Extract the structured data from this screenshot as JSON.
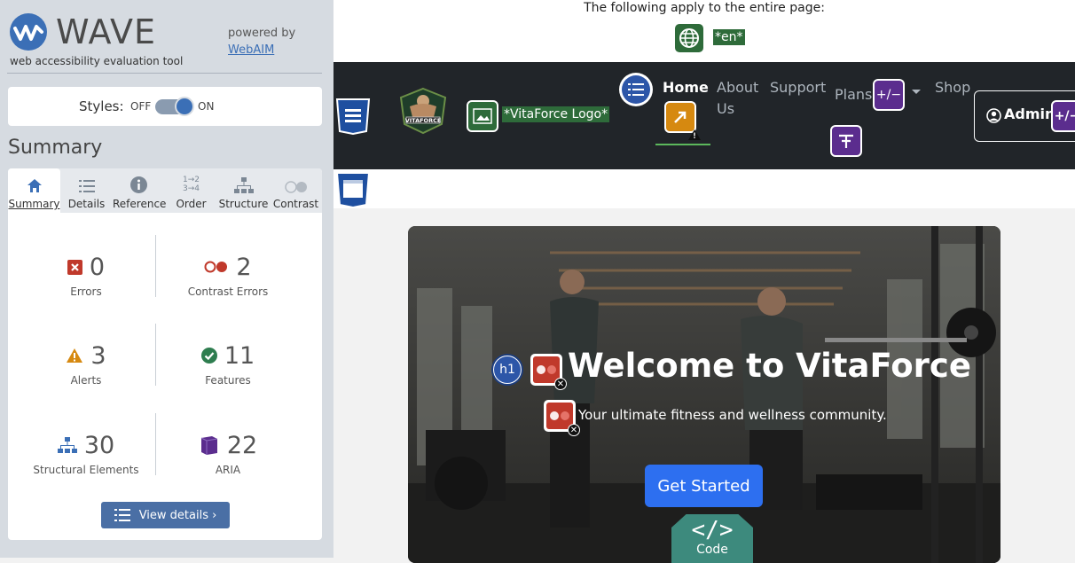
{
  "wave": {
    "title": "WAVE",
    "subtitle": "web accessibility evaluation tool",
    "powered_by": "powered by",
    "webaim_link": "WebAIM",
    "styles_label": "Styles:",
    "styles_off": "OFF",
    "styles_on": "ON",
    "summary_heading": "Summary",
    "tabs": [
      {
        "label": "Summary",
        "icon": "home-icon"
      },
      {
        "label": "Details",
        "icon": "list-icon"
      },
      {
        "label": "Reference",
        "icon": "info-icon"
      },
      {
        "label": "Order",
        "icon": "order-icon"
      },
      {
        "label": "Structure",
        "icon": "structure-icon"
      },
      {
        "label": "Contrast",
        "icon": "contrast-icon"
      }
    ],
    "stats": {
      "errors": {
        "count": "0",
        "label": "Errors"
      },
      "contrast_errors": {
        "count": "2",
        "label": "Contrast Errors"
      },
      "alerts": {
        "count": "3",
        "label": "Alerts"
      },
      "features": {
        "count": "11",
        "label": "Features"
      },
      "structural": {
        "count": "30",
        "label": "Structural Elements"
      },
      "aria": {
        "count": "22",
        "label": "ARIA"
      }
    },
    "view_details": "View details ›",
    "colors": {
      "accent": "#3b6fb6",
      "error": "#c0392b",
      "alert": "#d68910",
      "feature": "#2e7d4f",
      "aria": "#5b2d8e"
    }
  },
  "page": {
    "applies_text": "The following apply to the entire page:",
    "lang_tag": "*en*",
    "logo_alt_tag": "*VitaForce Logo*",
    "nav": {
      "home": "Home",
      "about": "About Us",
      "support": "Support",
      "plans": "Plans",
      "shop": "Shop",
      "admin": "Admin",
      "aria_tag": "+/−"
    },
    "hero": {
      "title": "Welcome to VitaForce",
      "subtitle": "Your ultimate fitness and wellness community.",
      "cta": "Get Started",
      "h1_tag": "h1",
      "code_tag": "Code"
    }
  }
}
